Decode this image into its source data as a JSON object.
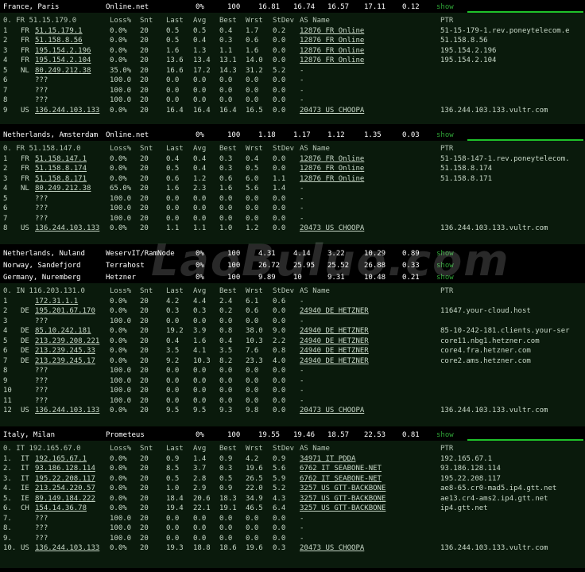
{
  "colors": {
    "bar_bg": "#000000",
    "panel_bg": "#0a1a0c",
    "text": "#c8d8c8",
    "show_link": "#2fa336",
    "graph": "#1fc12a"
  },
  "watermark": "LaoBuluo.com",
  "header_labels": [
    "Loss%",
    "Snt",
    "Last",
    "Avg",
    "Best",
    "Wrst",
    "StDev",
    "AS Name",
    "PTR"
  ],
  "sections": [
    {
      "summary": {
        "location": "France, Paris",
        "provider": "Online.net",
        "loss": "0%",
        "snt": "100",
        "avg": "16.81",
        "best": "16.74",
        "med": "16.57",
        "worst": "17.11",
        "stdev": "0.12",
        "show": "show"
      },
      "first_hop": "0.  FR 51.15.179.0",
      "hops": [
        {
          "hop": "1",
          "cc": "FR",
          "ip": "51.15.179.1",
          "loss": "0.0%",
          "snt": "20",
          "last": "0.5",
          "avg": "0.5",
          "best": "0.4",
          "wrst": "1.7",
          "stdev": "0.2",
          "as": "12876 FR Online",
          "ptr": "51-15-179-1.rev.poneytelecom.e"
        },
        {
          "hop": "2",
          "cc": "FR",
          "ip": "51.158.8.56",
          "loss": "0.0%",
          "snt": "20",
          "last": "0.5",
          "avg": "0.4",
          "best": "0.3",
          "wrst": "0.6",
          "stdev": "0.0",
          "as": "12876 FR Online",
          "ptr": "51.158.8.56"
        },
        {
          "hop": "3",
          "cc": "FR",
          "ip": "195.154.2.196",
          "loss": "0.0%",
          "snt": "20",
          "last": "1.6",
          "avg": "1.3",
          "best": "1.1",
          "wrst": "1.6",
          "stdev": "0.0",
          "as": "12876 FR Online",
          "ptr": "195.154.2.196"
        },
        {
          "hop": "4",
          "cc": "FR",
          "ip": "195.154.2.104",
          "loss": "0.0%",
          "snt": "20",
          "last": "13.6",
          "avg": "13.4",
          "best": "13.1",
          "wrst": "14.0",
          "stdev": "0.0",
          "as": "12876 FR Online",
          "ptr": "195.154.2.104"
        },
        {
          "hop": "5",
          "cc": "NL",
          "ip": "80.249.212.38",
          "loss": "35.0%",
          "snt": "20",
          "last": "16.6",
          "avg": "17.2",
          "best": "14.3",
          "wrst": "31.2",
          "stdev": "5.2",
          "as": "-",
          "ptr": ""
        },
        {
          "hop": "6",
          "cc": "",
          "ip": "???",
          "loss": "100.0",
          "snt": "20",
          "last": "0.0",
          "avg": "0.0",
          "best": "0.0",
          "wrst": "0.0",
          "stdev": "0.0",
          "as": "-",
          "ptr": ""
        },
        {
          "hop": "7",
          "cc": "",
          "ip": "???",
          "loss": "100.0",
          "snt": "20",
          "last": "0.0",
          "avg": "0.0",
          "best": "0.0",
          "wrst": "0.0",
          "stdev": "0.0",
          "as": "-",
          "ptr": ""
        },
        {
          "hop": "8",
          "cc": "",
          "ip": "???",
          "loss": "100.0",
          "snt": "20",
          "last": "0.0",
          "avg": "0.0",
          "best": "0.0",
          "wrst": "0.0",
          "stdev": "0.0",
          "as": "-",
          "ptr": ""
        },
        {
          "hop": "9",
          "cc": "US",
          "ip": "136.244.103.133",
          "loss": "0.0%",
          "snt": "20",
          "last": "16.4",
          "avg": "16.4",
          "best": "16.4",
          "wrst": "16.5",
          "stdev": "0.0",
          "as": "20473 US CHOOPA",
          "ptr": "136.244.103.133.vultr.com"
        }
      ]
    },
    {
      "summary": {
        "location": "Netherlands, Amsterdam",
        "provider": "Online.net",
        "loss": "0%",
        "snt": "100",
        "avg": "1.18",
        "best": "1.17",
        "med": "1.12",
        "worst": "1.35",
        "stdev": "0.03",
        "show": "show"
      },
      "first_hop": "0.  FR 51.158.147.0",
      "hops": [
        {
          "hop": "1",
          "cc": "FR",
          "ip": "51.158.147.1",
          "loss": "0.0%",
          "snt": "20",
          "last": "0.4",
          "avg": "0.4",
          "best": "0.3",
          "wrst": "0.4",
          "stdev": "0.0",
          "as": "12876 FR Online",
          "ptr": "51-158-147-1.rev.poneytelecom."
        },
        {
          "hop": "2",
          "cc": "FR",
          "ip": "51.158.8.174",
          "loss": "0.0%",
          "snt": "20",
          "last": "0.5",
          "avg": "0.4",
          "best": "0.3",
          "wrst": "0.5",
          "stdev": "0.0",
          "as": "12876 FR Online",
          "ptr": "51.158.8.174"
        },
        {
          "hop": "3",
          "cc": "FR",
          "ip": "51.158.8.171",
          "loss": "0.0%",
          "snt": "20",
          "last": "0.6",
          "avg": "1.2",
          "best": "0.6",
          "wrst": "6.0",
          "stdev": "1.1",
          "as": "12876 FR Online",
          "ptr": "51.158.8.171"
        },
        {
          "hop": "4",
          "cc": "NL",
          "ip": "80.249.212.38",
          "loss": "65.0%",
          "snt": "20",
          "last": "1.6",
          "avg": "2.3",
          "best": "1.6",
          "wrst": "5.6",
          "stdev": "1.4",
          "as": "-",
          "ptr": ""
        },
        {
          "hop": "5",
          "cc": "",
          "ip": "???",
          "loss": "100.0",
          "snt": "20",
          "last": "0.0",
          "avg": "0.0",
          "best": "0.0",
          "wrst": "0.0",
          "stdev": "0.0",
          "as": "-",
          "ptr": ""
        },
        {
          "hop": "6",
          "cc": "",
          "ip": "???",
          "loss": "100.0",
          "snt": "20",
          "last": "0.0",
          "avg": "0.0",
          "best": "0.0",
          "wrst": "0.0",
          "stdev": "0.0",
          "as": "-",
          "ptr": ""
        },
        {
          "hop": "7",
          "cc": "",
          "ip": "???",
          "loss": "100.0",
          "snt": "20",
          "last": "0.0",
          "avg": "0.0",
          "best": "0.0",
          "wrst": "0.0",
          "stdev": "0.0",
          "as": "-",
          "ptr": ""
        },
        {
          "hop": "8",
          "cc": "US",
          "ip": "136.244.103.133",
          "loss": "0.0%",
          "snt": "20",
          "last": "1.1",
          "avg": "1.1",
          "best": "1.0",
          "wrst": "1.2",
          "stdev": "0.0",
          "as": "20473 US CHOOPA",
          "ptr": "136.244.103.133.vultr.com"
        }
      ]
    }
  ],
  "summaries": [
    {
      "location": "Netherlands, Nuland",
      "provider": "WeservIT/RamNode",
      "loss": "0%",
      "snt": "100",
      "avg": "4.31",
      "best": "4.14",
      "med": "3.22",
      "worst": "10.29",
      "stdev": "0.89",
      "show": "show"
    },
    {
      "location": "Norway, Sandefjord",
      "provider": "Terrahost",
      "loss": "0%",
      "snt": "100",
      "avg": "26.72",
      "best": "25.95",
      "med": "25.52",
      "worst": "26.88",
      "stdev": "0.33",
      "show": "show"
    },
    {
      "location": "Germany, Nuremberg",
      "provider": "Hetzner",
      "loss": "0%",
      "snt": "100",
      "avg": "9.89",
      "best": "10",
      "med": "9.31",
      "worst": "10.48",
      "stdev": "0.21",
      "show": "show"
    }
  ],
  "sections2": [
    {
      "first_hop": "0.  IN 116.203.131.0",
      "hops": [
        {
          "hop": "1",
          "cc": "",
          "ip": "172.31.1.1",
          "loss": "0.0%",
          "snt": "20",
          "last": "4.2",
          "avg": "4.4",
          "best": "2.4",
          "wrst": "6.1",
          "stdev": "0.6",
          "as": "-",
          "ptr": ""
        },
        {
          "hop": "2",
          "cc": "DE",
          "ip": "195.201.67.170",
          "loss": "0.0%",
          "snt": "20",
          "last": "0.3",
          "avg": "0.3",
          "best": "0.2",
          "wrst": "0.6",
          "stdev": "0.0",
          "as": "24940 DE HETZNER",
          "ptr": "11647.your-cloud.host"
        },
        {
          "hop": "3",
          "cc": "",
          "ip": "???",
          "loss": "100.0",
          "snt": "20",
          "last": "0.0",
          "avg": "0.0",
          "best": "0.0",
          "wrst": "0.0",
          "stdev": "0.0",
          "as": "-",
          "ptr": ""
        },
        {
          "hop": "4",
          "cc": "DE",
          "ip": "85.10.242.181",
          "loss": "0.0%",
          "snt": "20",
          "last": "19.2",
          "avg": "3.9",
          "best": "0.8",
          "wrst": "38.0",
          "stdev": "9.0",
          "as": "24940 DE HETZNER",
          "ptr": "85-10-242-181.clients.your-ser"
        },
        {
          "hop": "5",
          "cc": "DE",
          "ip": "213.239.208.221",
          "loss": "0.0%",
          "snt": "20",
          "last": "0.4",
          "avg": "1.6",
          "best": "0.4",
          "wrst": "10.3",
          "stdev": "2.2",
          "as": "24940 DE HETZNER",
          "ptr": "core11.nbg1.hetzner.com"
        },
        {
          "hop": "6",
          "cc": "DE",
          "ip": "213.239.245.33",
          "loss": "0.0%",
          "snt": "20",
          "last": "3.5",
          "avg": "4.1",
          "best": "3.5",
          "wrst": "7.6",
          "stdev": "0.8",
          "as": "24940 DE HETZNER",
          "ptr": "core4.fra.hetzner.com"
        },
        {
          "hop": "7",
          "cc": "DE",
          "ip": "213.239.245.17",
          "loss": "0.0%",
          "snt": "20",
          "last": "9.2",
          "avg": "10.3",
          "best": "8.2",
          "wrst": "23.3",
          "stdev": "4.0",
          "as": "24940 DE HETZNER",
          "ptr": "core2.ams.hetzner.com"
        },
        {
          "hop": "8",
          "cc": "",
          "ip": "???",
          "loss": "100.0",
          "snt": "20",
          "last": "0.0",
          "avg": "0.0",
          "best": "0.0",
          "wrst": "0.0",
          "stdev": "0.0",
          "as": "-",
          "ptr": ""
        },
        {
          "hop": "9",
          "cc": "",
          "ip": "???",
          "loss": "100.0",
          "snt": "20",
          "last": "0.0",
          "avg": "0.0",
          "best": "0.0",
          "wrst": "0.0",
          "stdev": "0.0",
          "as": "-",
          "ptr": ""
        },
        {
          "hop": "10",
          "cc": "",
          "ip": "???",
          "loss": "100.0",
          "snt": "20",
          "last": "0.0",
          "avg": "0.0",
          "best": "0.0",
          "wrst": "0.0",
          "stdev": "0.0",
          "as": "-",
          "ptr": ""
        },
        {
          "hop": "11",
          "cc": "",
          "ip": "???",
          "loss": "100.0",
          "snt": "20",
          "last": "0.0",
          "avg": "0.0",
          "best": "0.0",
          "wrst": "0.0",
          "stdev": "0.0",
          "as": "-",
          "ptr": ""
        },
        {
          "hop": "12",
          "cc": "US",
          "ip": "136.244.103.133",
          "loss": "0.0%",
          "snt": "20",
          "last": "9.5",
          "avg": "9.5",
          "best": "9.3",
          "wrst": "9.8",
          "stdev": "0.0",
          "as": "20473 US CHOOPA",
          "ptr": "136.244.103.133.vultr.com"
        }
      ]
    },
    {
      "summary": {
        "location": "Italy, Milan",
        "provider": "Prometeus",
        "loss": "0%",
        "snt": "100",
        "avg": "19.55",
        "best": "19.46",
        "med": "18.57",
        "worst": "22.53",
        "stdev": "0.81",
        "show": "show"
      },
      "first_hop": "0.  IT 192.165.67.0",
      "hops": [
        {
          "hop": "1.",
          "cc": "IT",
          "ip": "192.165.67.1",
          "loss": "0.0%",
          "snt": "20",
          "last": "0.9",
          "avg": "1.4",
          "best": "0.9",
          "wrst": "4.2",
          "stdev": "0.9",
          "as": "34971 IT PDDA",
          "ptr": "192.165.67.1"
        },
        {
          "hop": "2.",
          "cc": "IT",
          "ip": "93.186.128.114",
          "loss": "0.0%",
          "snt": "20",
          "last": "8.5",
          "avg": "3.7",
          "best": "0.3",
          "wrst": "19.6",
          "stdev": "5.6",
          "as": "6762  IT SEABONE-NET",
          "ptr": "93.186.128.114"
        },
        {
          "hop": "3.",
          "cc": "IT",
          "ip": "195.22.208.117",
          "loss": "0.0%",
          "snt": "20",
          "last": "0.5",
          "avg": "2.8",
          "best": "0.5",
          "wrst": "26.5",
          "stdev": "5.9",
          "as": "6762  IT SEABONE-NET",
          "ptr": "195.22.208.117"
        },
        {
          "hop": "4.",
          "cc": "IE",
          "ip": "213.254.220.57",
          "loss": "0.0%",
          "snt": "20",
          "last": "1.0",
          "avg": "2.9",
          "best": "0.9",
          "wrst": "22.0",
          "stdev": "5.2",
          "as": "3257  US GTT-BACKBONE",
          "ptr": "ae8-65.cr0-mad5.ip4.gtt.net"
        },
        {
          "hop": "5.",
          "cc": "IE",
          "ip": "89.149.184.222",
          "loss": "0.0%",
          "snt": "20",
          "last": "18.4",
          "avg": "20.6",
          "best": "18.3",
          "wrst": "34.9",
          "stdev": "4.3",
          "as": "3257  US GTT-BACKBONE",
          "ptr": "ae13.cr4-ams2.ip4.gtt.net"
        },
        {
          "hop": "6.",
          "cc": "CH",
          "ip": "154.14.36.78",
          "loss": "0.0%",
          "snt": "20",
          "last": "19.4",
          "avg": "22.1",
          "best": "19.1",
          "wrst": "46.5",
          "stdev": "6.4",
          "as": "3257  US GTT-BACKBONE",
          "ptr": "ip4.gtt.net"
        },
        {
          "hop": "7.",
          "cc": "",
          "ip": "???",
          "loss": "100.0",
          "snt": "20",
          "last": "0.0",
          "avg": "0.0",
          "best": "0.0",
          "wrst": "0.0",
          "stdev": "0.0",
          "as": "-",
          "ptr": ""
        },
        {
          "hop": "8.",
          "cc": "",
          "ip": "???",
          "loss": "100.0",
          "snt": "20",
          "last": "0.0",
          "avg": "0.0",
          "best": "0.0",
          "wrst": "0.0",
          "stdev": "0.0",
          "as": "-",
          "ptr": ""
        },
        {
          "hop": "9.",
          "cc": "",
          "ip": "???",
          "loss": "100.0",
          "snt": "20",
          "last": "0.0",
          "avg": "0.0",
          "best": "0.0",
          "wrst": "0.0",
          "stdev": "0.0",
          "as": "-",
          "ptr": ""
        },
        {
          "hop": "10.",
          "cc": "US",
          "ip": "136.244.103.133",
          "loss": "0.0%",
          "snt": "20",
          "last": "19.3",
          "avg": "18.8",
          "best": "18.6",
          "wrst": "19.6",
          "stdev": "0.3",
          "as": "20473 US CHOOPA",
          "ptr": "136.244.103.133.vultr.com"
        }
      ]
    }
  ]
}
